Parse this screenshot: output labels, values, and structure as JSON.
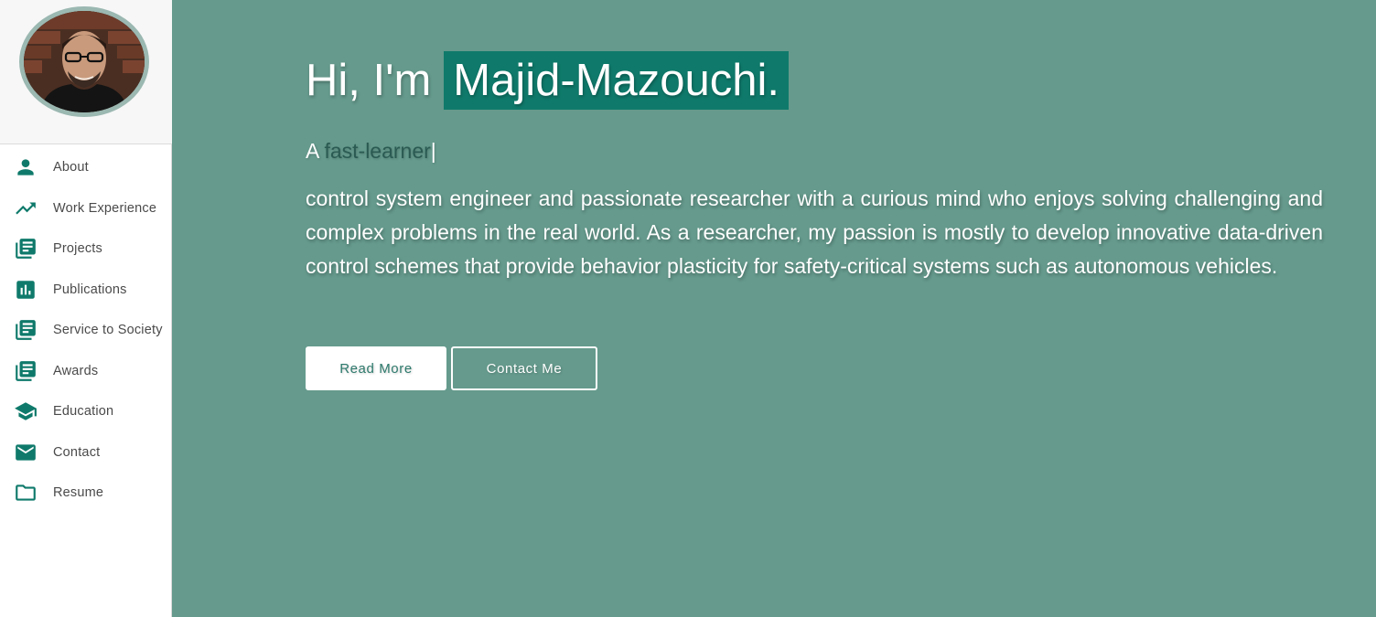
{
  "sidebar": {
    "avatar_alt": "Profile photo",
    "items": [
      {
        "label": "About",
        "icon": "person-icon"
      },
      {
        "label": "Work Experience",
        "icon": "trending-up-icon"
      },
      {
        "label": "Projects",
        "icon": "library-books-icon"
      },
      {
        "label": "Publications",
        "icon": "bar-chart-icon"
      },
      {
        "label": "Service to Society",
        "icon": "library-books-icon"
      },
      {
        "label": "Awards",
        "icon": "library-books-icon"
      },
      {
        "label": "Education",
        "icon": "school-icon"
      },
      {
        "label": "Contact",
        "icon": "mail-icon"
      },
      {
        "label": "Resume",
        "icon": "folder-icon"
      }
    ]
  },
  "hero": {
    "greeting_prefix": "Hi, I'm",
    "name": "Majid-Mazouchi.",
    "tagline_prefix": "A",
    "tagline_typed": "fast-learner",
    "tagline_caret": "|",
    "bio": "control system engineer and passionate researcher with a curious mind who enjoys solving challenging and complex problems in the real world. As a researcher, my passion is mostly to develop innovative data-driven control schemes that provide behavior plasticity for safety-critical systems such as autonomous vehicles.",
    "read_more_label": "Read More",
    "contact_label": "Contact Me"
  },
  "colors": {
    "main_bg": "#659a8c",
    "accent": "#0f7a6b",
    "sidebar_bg": "#ffffff",
    "typed_text": "#2a5a52"
  }
}
